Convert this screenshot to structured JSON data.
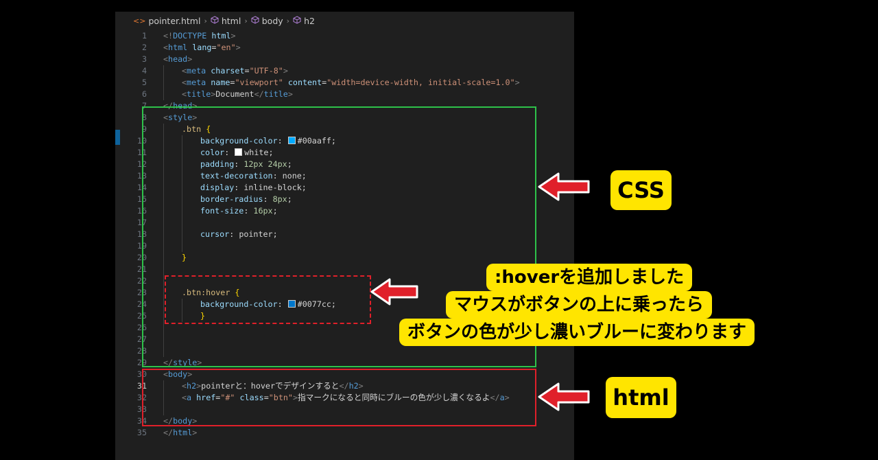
{
  "breadcrumb": {
    "file": "pointer.html",
    "items": [
      "html",
      "body",
      "h2"
    ]
  },
  "code_lines": [
    {
      "n": "1",
      "indent": 0,
      "tokens": [
        [
          "p",
          "<!"
        ],
        [
          "t",
          "DOCTYPE"
        ],
        [
          "w",
          " "
        ],
        [
          "a",
          "html"
        ],
        [
          "p",
          ">"
        ]
      ]
    },
    {
      "n": "2",
      "indent": 0,
      "tokens": [
        [
          "p",
          "<"
        ],
        [
          "t",
          "html"
        ],
        [
          "w",
          " "
        ],
        [
          "a",
          "lang"
        ],
        [
          "w",
          "="
        ],
        [
          "s",
          "\"en\""
        ],
        [
          "p",
          ">"
        ]
      ]
    },
    {
      "n": "3",
      "indent": 0,
      "tokens": [
        [
          "p",
          "<"
        ],
        [
          "t",
          "head"
        ],
        [
          "p",
          ">"
        ]
      ]
    },
    {
      "n": "4",
      "indent": 1,
      "tokens": [
        [
          "p",
          "<"
        ],
        [
          "t",
          "meta"
        ],
        [
          "w",
          " "
        ],
        [
          "a",
          "charset"
        ],
        [
          "w",
          "="
        ],
        [
          "s",
          "\"UTF-8\""
        ],
        [
          "p",
          ">"
        ]
      ]
    },
    {
      "n": "5",
      "indent": 1,
      "tokens": [
        [
          "p",
          "<"
        ],
        [
          "t",
          "meta"
        ],
        [
          "w",
          " "
        ],
        [
          "a",
          "name"
        ],
        [
          "w",
          "="
        ],
        [
          "s",
          "\"viewport\""
        ],
        [
          "w",
          " "
        ],
        [
          "a",
          "content"
        ],
        [
          "w",
          "="
        ],
        [
          "s",
          "\"width=device-width, initial-scale=1.0\""
        ],
        [
          "p",
          ">"
        ]
      ]
    },
    {
      "n": "6",
      "indent": 1,
      "tokens": [
        [
          "p",
          "<"
        ],
        [
          "t",
          "title"
        ],
        [
          "p",
          ">"
        ],
        [
          "w",
          "Document"
        ],
        [
          "p",
          "</"
        ],
        [
          "t",
          "title"
        ],
        [
          "p",
          ">"
        ]
      ]
    },
    {
      "n": "7",
      "indent": 0,
      "tokens": [
        [
          "p",
          "</"
        ],
        [
          "t",
          "head"
        ],
        [
          "p",
          ">"
        ]
      ]
    },
    {
      "n": "8",
      "indent": 0,
      "tokens": [
        [
          "p",
          "<"
        ],
        [
          "t",
          "style"
        ],
        [
          "p",
          ">"
        ]
      ]
    },
    {
      "n": "9",
      "indent": 1,
      "tokens": [
        [
          "sel",
          ".btn"
        ],
        [
          "w",
          " "
        ],
        [
          "b",
          "{"
        ]
      ]
    },
    {
      "n": "10",
      "indent": 2,
      "tokens": [
        [
          "a",
          "background-color"
        ],
        [
          "w",
          ": "
        ],
        [
          "swatch",
          "#00aaff"
        ],
        [
          "w",
          "#00aaff;"
        ]
      ]
    },
    {
      "n": "11",
      "indent": 2,
      "tokens": [
        [
          "a",
          "color"
        ],
        [
          "w",
          ": "
        ],
        [
          "swatch",
          "#ffffff"
        ],
        [
          "w",
          "white;"
        ]
      ]
    },
    {
      "n": "12",
      "indent": 2,
      "tokens": [
        [
          "a",
          "padding"
        ],
        [
          "w",
          ": "
        ],
        [
          "n",
          "12px 24px"
        ],
        [
          "w",
          ";"
        ]
      ]
    },
    {
      "n": "13",
      "indent": 2,
      "tokens": [
        [
          "a",
          "text-decoration"
        ],
        [
          "w",
          ": "
        ],
        [
          "w",
          "none;"
        ]
      ]
    },
    {
      "n": "14",
      "indent": 2,
      "tokens": [
        [
          "a",
          "display"
        ],
        [
          "w",
          ": "
        ],
        [
          "w",
          "inline-block;"
        ]
      ]
    },
    {
      "n": "15",
      "indent": 2,
      "tokens": [
        [
          "a",
          "border-radius"
        ],
        [
          "w",
          ": "
        ],
        [
          "n",
          "8px"
        ],
        [
          "w",
          ";"
        ]
      ]
    },
    {
      "n": "16",
      "indent": 2,
      "tokens": [
        [
          "a",
          "font-size"
        ],
        [
          "w",
          ": "
        ],
        [
          "n",
          "16px"
        ],
        [
          "w",
          ";"
        ]
      ]
    },
    {
      "n": "17",
      "indent": 2,
      "tokens": []
    },
    {
      "n": "18",
      "indent": 2,
      "tokens": [
        [
          "a",
          "cursor"
        ],
        [
          "w",
          ": "
        ],
        [
          "w",
          "pointer;"
        ]
      ]
    },
    {
      "n": "19",
      "indent": 2,
      "tokens": []
    },
    {
      "n": "20",
      "indent": 1,
      "tokens": [
        [
          "b",
          "}"
        ]
      ]
    },
    {
      "n": "21",
      "indent": 1,
      "tokens": []
    },
    {
      "n": "22",
      "indent": 1,
      "tokens": []
    },
    {
      "n": "23",
      "indent": 1,
      "tokens": [
        [
          "sel",
          ".btn:hover"
        ],
        [
          "w",
          " "
        ],
        [
          "b",
          "{"
        ]
      ]
    },
    {
      "n": "24",
      "indent": 2,
      "tokens": [
        [
          "a",
          "background-color"
        ],
        [
          "w",
          ": "
        ],
        [
          "swatch",
          "#0077cc"
        ],
        [
          "w",
          "#0077cc;"
        ]
      ]
    },
    {
      "n": "25",
      "indent": 2,
      "tokens": [
        [
          "b",
          "}"
        ]
      ]
    },
    {
      "n": "26",
      "indent": 1,
      "tokens": []
    },
    {
      "n": "27",
      "indent": 1,
      "tokens": []
    },
    {
      "n": "28",
      "indent": 1,
      "tokens": []
    },
    {
      "n": "29",
      "indent": 0,
      "tokens": [
        [
          "p",
          "</"
        ],
        [
          "t",
          "style"
        ],
        [
          "p",
          ">"
        ]
      ]
    },
    {
      "n": "30",
      "indent": 0,
      "tokens": [
        [
          "p",
          "<"
        ],
        [
          "t",
          "body"
        ],
        [
          "p",
          ">"
        ]
      ]
    },
    {
      "n": "31",
      "indent": 1,
      "tokens": [
        [
          "p",
          "<"
        ],
        [
          "t",
          "h2"
        ],
        [
          "p",
          ">"
        ],
        [
          "w",
          "pointerと：hoverでデザインすると"
        ],
        [
          "p",
          "</"
        ],
        [
          "t",
          "h2"
        ],
        [
          "p",
          ">"
        ]
      ]
    },
    {
      "n": "32",
      "indent": 1,
      "tokens": [
        [
          "p",
          "<"
        ],
        [
          "t",
          "a"
        ],
        [
          "w",
          " "
        ],
        [
          "a",
          "href"
        ],
        [
          "w",
          "="
        ],
        [
          "s",
          "\"#\""
        ],
        [
          "w",
          " "
        ],
        [
          "a",
          "class"
        ],
        [
          "w",
          "="
        ],
        [
          "s",
          "\"btn\""
        ],
        [
          "p",
          ">"
        ],
        [
          "w",
          "指マークになると同時にブルーの色が少し濃くなるよ"
        ],
        [
          "p",
          "</"
        ],
        [
          "t",
          "a"
        ],
        [
          "p",
          ">"
        ]
      ]
    },
    {
      "n": "33",
      "indent": 1,
      "tokens": []
    },
    {
      "n": "34",
      "indent": 0,
      "tokens": [
        [
          "p",
          "</"
        ],
        [
          "t",
          "body"
        ],
        [
          "p",
          ">"
        ]
      ]
    },
    {
      "n": "35",
      "indent": 0,
      "tokens": [
        [
          "p",
          "</"
        ],
        [
          "t",
          "html"
        ],
        [
          "p",
          ">"
        ]
      ]
    }
  ],
  "active_line": "31",
  "callouts": {
    "css": "CSS",
    "hover_lines": [
      ":hoverを追加しました",
      "マウスがボタンの上に乗ったら",
      "ボタンの色が少し濃いブルーに変わります"
    ],
    "html": "html"
  },
  "colors": {
    "green_box": "#2ec24a",
    "red_box": "#e0202a",
    "callout_bg": "#ffe500",
    "editor_bg": "#1f1f1f"
  }
}
